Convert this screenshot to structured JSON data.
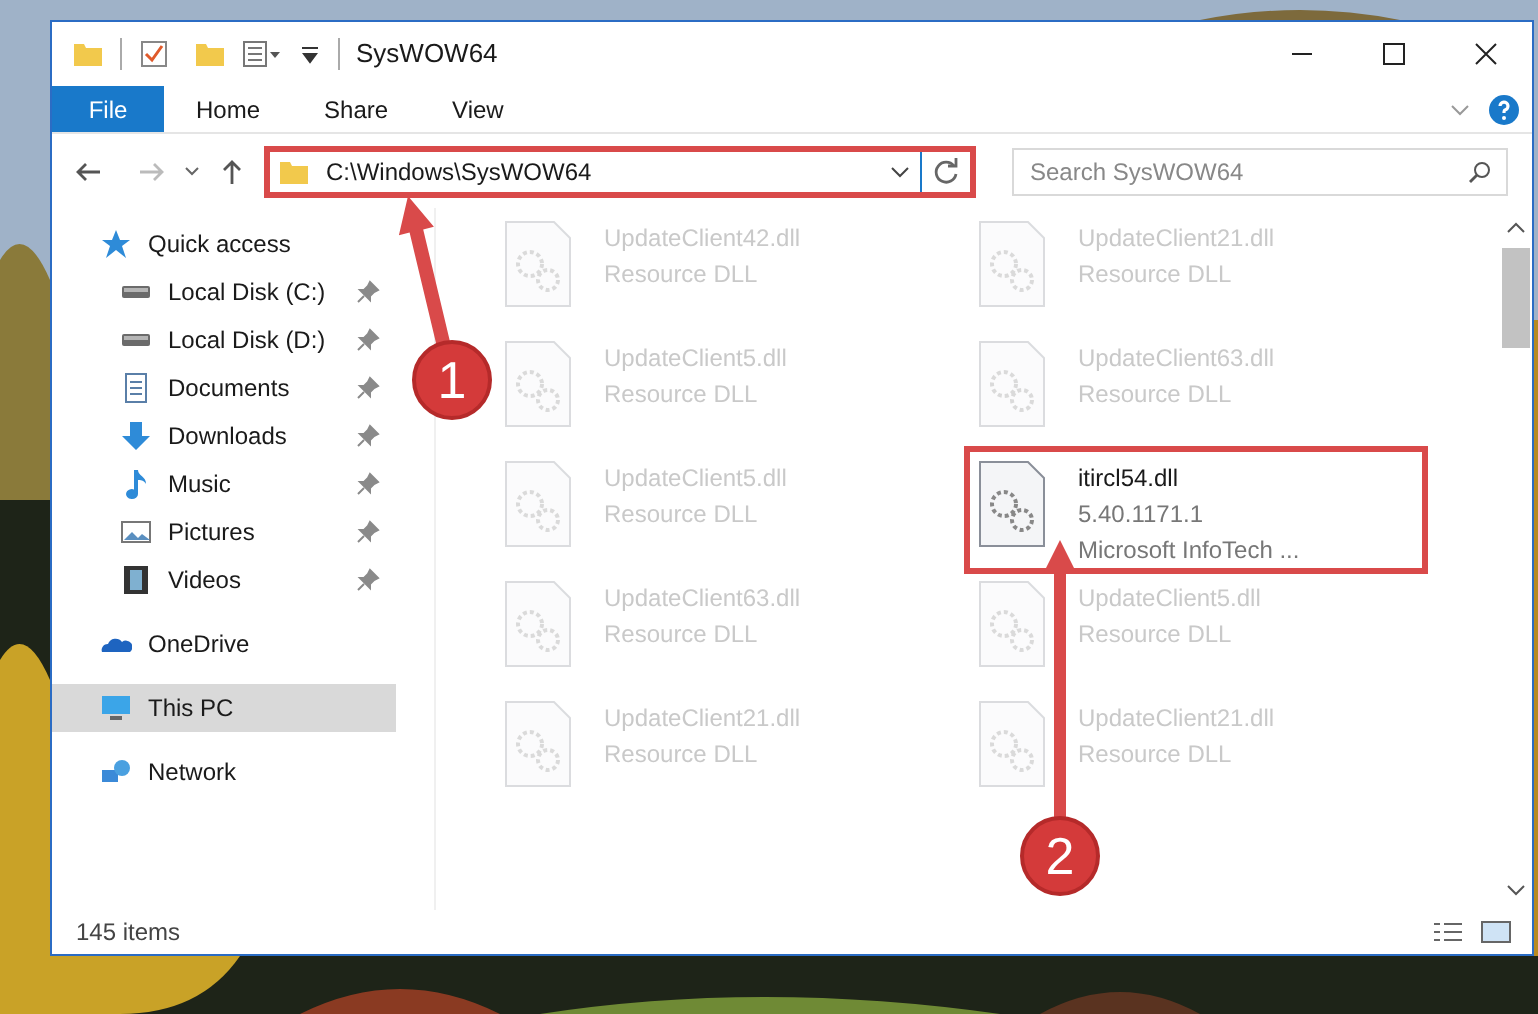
{
  "window": {
    "title": "SysWOW64"
  },
  "ribbon_tabs": [
    {
      "label": "File",
      "kind": "file",
      "selected": false
    },
    {
      "label": "Home",
      "kind": "tab",
      "selected": false
    },
    {
      "label": "Share",
      "kind": "tab",
      "selected": false
    },
    {
      "label": "View",
      "kind": "tab",
      "selected": false
    }
  ],
  "address": {
    "path": "C:\\Windows\\SysWOW64",
    "highlighted": true
  },
  "search": {
    "placeholder": "Search SysWOW64"
  },
  "sidebar": {
    "items": [
      {
        "label": "Quick access",
        "kind": "star",
        "selected": false,
        "children": [
          {
            "label": "Local Disk (C:)",
            "kind": "drive",
            "selected": false,
            "pinned": true
          },
          {
            "label": "Local Disk (D:)",
            "kind": "drive",
            "selected": false,
            "pinned": true
          },
          {
            "label": "Documents",
            "kind": "documents",
            "selected": false,
            "pinned": true
          },
          {
            "label": "Downloads",
            "kind": "downloads",
            "selected": false,
            "pinned": true
          },
          {
            "label": "Music",
            "kind": "music",
            "selected": false,
            "pinned": true
          },
          {
            "label": "Pictures",
            "kind": "pictures",
            "selected": false,
            "pinned": true
          },
          {
            "label": "Videos",
            "kind": "videos",
            "selected": false,
            "pinned": true
          }
        ]
      },
      {
        "label": "OneDrive",
        "kind": "cloud",
        "selected": false
      },
      {
        "label": "This PC",
        "kind": "pc",
        "selected": true
      },
      {
        "label": "Network",
        "kind": "network",
        "selected": false
      }
    ]
  },
  "files": [
    {
      "name": "UpdateClient42.dll",
      "line_2": "Resource DLL",
      "faded": true,
      "highlighted": false
    },
    {
      "name": "UpdateClient21.dll",
      "line_2": "Resource DLL",
      "faded": true,
      "highlighted": false
    },
    {
      "name": "UpdateClient5.dll",
      "line_2": "Resource DLL",
      "faded": true,
      "highlighted": false
    },
    {
      "name": "UpdateClient63.dll",
      "line_2": "Resource DLL",
      "faded": true,
      "highlighted": false
    },
    {
      "name": "UpdateClient5.dll",
      "line_2": "Resource DLL",
      "faded": true,
      "highlighted": false
    },
    {
      "name": "itircl54.dll",
      "line_2": "5.40.1171.1",
      "line_3": "Microsoft InfoTech ...",
      "faded": false,
      "highlighted": true
    },
    {
      "name": "UpdateClient63.dll",
      "line_2": "Resource DLL",
      "faded": true,
      "highlighted": false
    },
    {
      "name": "UpdateClient5.dll",
      "line_2": "Resource DLL",
      "faded": true,
      "highlighted": false
    },
    {
      "name": "UpdateClient21.dll",
      "line_2": "Resource DLL",
      "faded": true,
      "highlighted": false
    },
    {
      "name": "UpdateClient21.dll",
      "line_2": "Resource DLL",
      "faded": true,
      "highlighted": false
    }
  ],
  "status_bar": {
    "count": "145 items"
  },
  "annotations": [
    {
      "number": "1"
    },
    {
      "number": "2"
    }
  ]
}
